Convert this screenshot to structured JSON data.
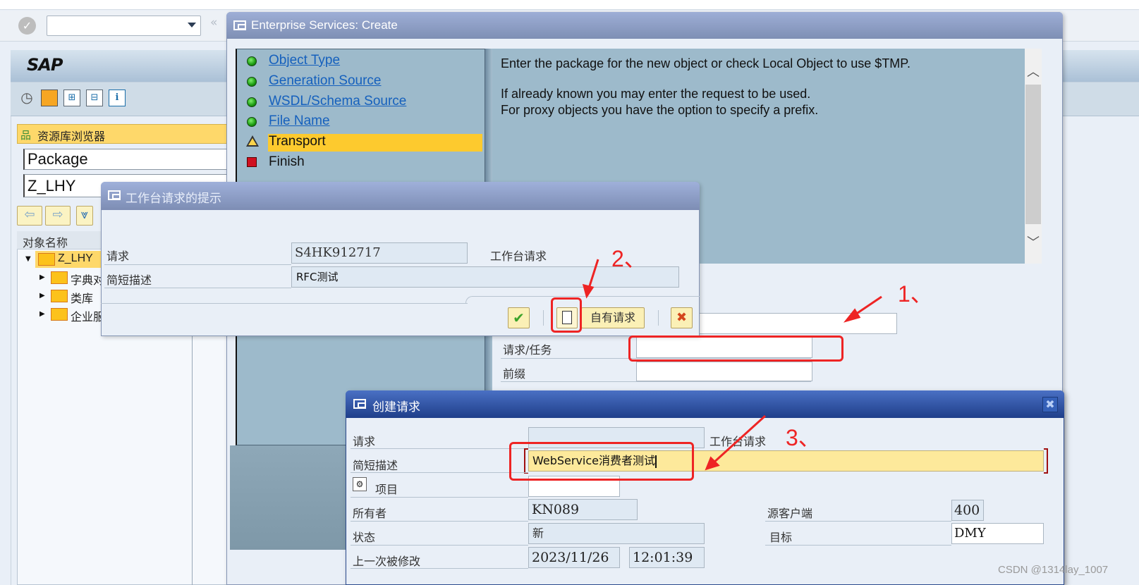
{
  "command_bar": {
    "ok_icon": "checkmark-circle-icon",
    "command_field_value": "",
    "collapse_icon": "«"
  },
  "sap": {
    "logo": "SAP",
    "toolbar_icons": [
      "clock-check-icon",
      "copy-object-icon",
      "expand-icon",
      "collapse-icon",
      "info-icon"
    ],
    "info_glyph": "i"
  },
  "repository_browser": {
    "title": "资源库浏览器",
    "object_type_select": "Package",
    "object_name_input": "Z_LHY",
    "nav_back": "⇦",
    "nav_forward": "⇨",
    "tree_header": "对象名称",
    "tree": [
      {
        "label": "Z_LHY",
        "expanded": true,
        "selected": true
      },
      {
        "label": "字典对象",
        "expanded": false
      },
      {
        "label": "类库",
        "expanded": false
      },
      {
        "label": "企业服务",
        "expanded": false
      }
    ]
  },
  "es_dialog": {
    "title": "Enterprise Services: Create",
    "steps": [
      {
        "label": "Object Type",
        "status": "done",
        "link": true
      },
      {
        "label": "Generation Source",
        "status": "done",
        "link": true
      },
      {
        "label": "WSDL/Schema Source",
        "status": "done",
        "link": true
      },
      {
        "label": "File Name",
        "status": "done",
        "link": true
      },
      {
        "label": "Transport",
        "status": "current",
        "link": false
      },
      {
        "label": "Finish",
        "status": "pending",
        "link": false
      }
    ],
    "help_lines": [
      "Enter the package for the new object or check Local Object to use $TMP.",
      "If already known you may enter the request to be used.",
      "For proxy objects you have the option to specify a prefix."
    ],
    "form": {
      "package_value": "",
      "request_task_label": "请求/任务",
      "request_task_value": "",
      "prefix_label": "前缀",
      "prefix_value": ""
    },
    "scroll_up": "⌃",
    "scroll_down": "⌄"
  },
  "workbench_dialog": {
    "title": "工作台请求的提示",
    "request_label": "请求",
    "request_value": "S4HK912717",
    "request_type": "工作台请求",
    "short_desc_label": "简短描述",
    "short_desc_value": "RFC测试",
    "confirm_glyph": "✔",
    "create_glyph": "🗋",
    "own_requests_label": "自有请求",
    "cancel_glyph": "✖"
  },
  "create_request_dialog": {
    "title": "创建请求",
    "close_glyph": "✖",
    "request_label": "请求",
    "request_value": "",
    "request_type": "工作台请求",
    "short_desc_label": "简短描述",
    "short_desc_value": "WebService消费者测试",
    "project_label": "项目",
    "project_value": "",
    "owner_label": "所有者",
    "owner_value": "KN089",
    "status_label": "状态",
    "status_value": "新",
    "last_changed_label": "上一次被修改",
    "last_changed_date": "2023/11/26",
    "last_changed_time": "12:01:39",
    "source_client_label": "源客户端",
    "source_client_value": "400",
    "target_label": "目标",
    "target_value": "DMY"
  },
  "annotations": {
    "step1": "1、",
    "step2": "2、",
    "step3": "3、",
    "color": "#ee2424"
  },
  "watermark": "CSDN @1314lay_1007"
}
